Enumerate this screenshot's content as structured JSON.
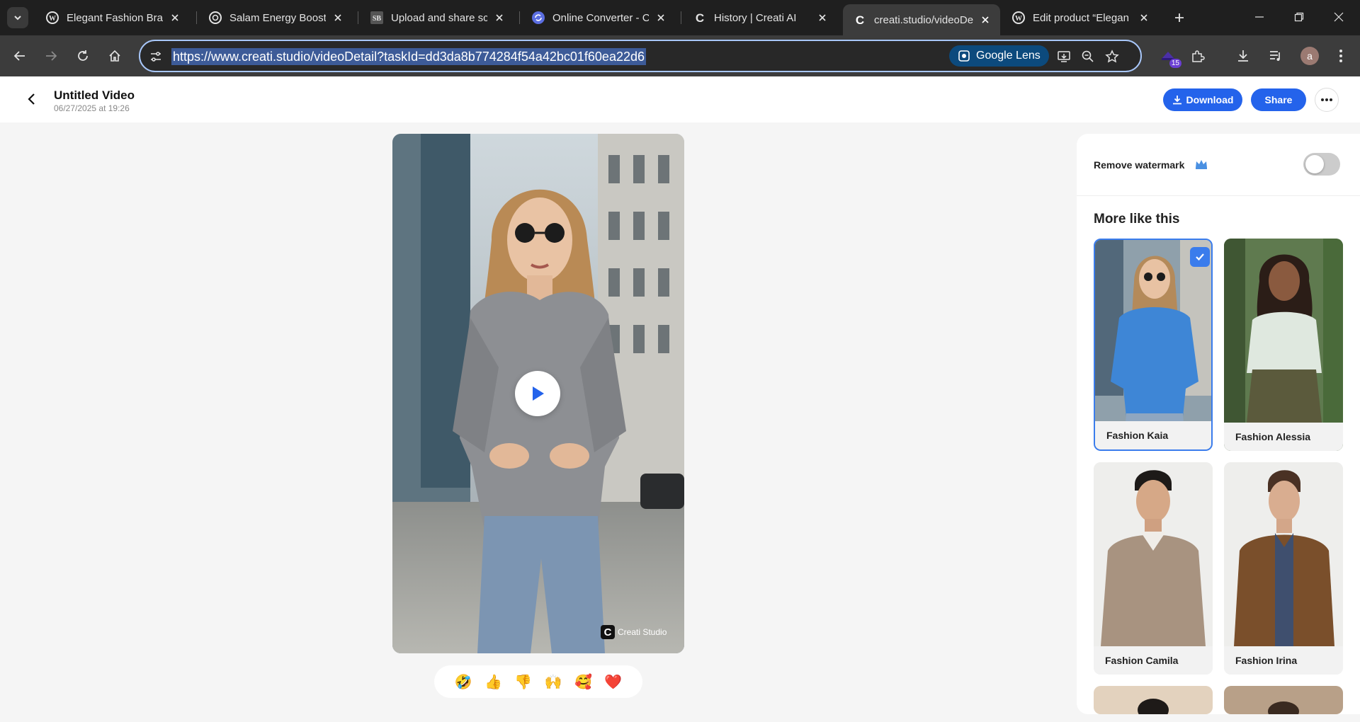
{
  "browser": {
    "tabs": [
      {
        "title": "Elegant Fashion Bran",
        "icon": "wordpress-icon"
      },
      {
        "title": "Salam Energy Boost",
        "icon": "openai-icon"
      },
      {
        "title": "Upload and share scr",
        "icon": "sb-icon"
      },
      {
        "title": "Online Converter - C",
        "icon": "converter-icon"
      },
      {
        "title": "History | Creati AI",
        "icon": "creati-icon"
      },
      {
        "title": "creati.studio/videoDe",
        "icon": "creati-icon",
        "active": true
      },
      {
        "title": "Edit product “Elegan",
        "icon": "wordpress-icon"
      }
    ],
    "url": "https://www.creati.studio/videoDetail?taskId=dd3da8b774284f54a42bc01f60ea22d6",
    "lens_label": "Google Lens",
    "extension_badge": "15",
    "profile_initial": "a"
  },
  "header": {
    "title": "Untitled Video",
    "date": "06/27/2025 at 19:26",
    "download_label": "Download",
    "share_label": "Share"
  },
  "video": {
    "watermark_text": "Creati Studio",
    "watermark_logo": "C"
  },
  "reactions": [
    "🤣",
    "👍",
    "👎",
    "🙌",
    "🥰",
    "❤️"
  ],
  "panel": {
    "remove_watermark_label": "Remove watermark",
    "remove_watermark_enabled": false,
    "more_like_title": "More like this",
    "cards": [
      {
        "label": "Fashion Kaia",
        "selected": true
      },
      {
        "label": "Fashion Alessia",
        "selected": false
      },
      {
        "label": "Fashion Camila",
        "selected": false
      },
      {
        "label": "Fashion Irina",
        "selected": false
      }
    ]
  },
  "colors": {
    "accent": "#2463eb",
    "selected_border": "#3a7cec"
  }
}
